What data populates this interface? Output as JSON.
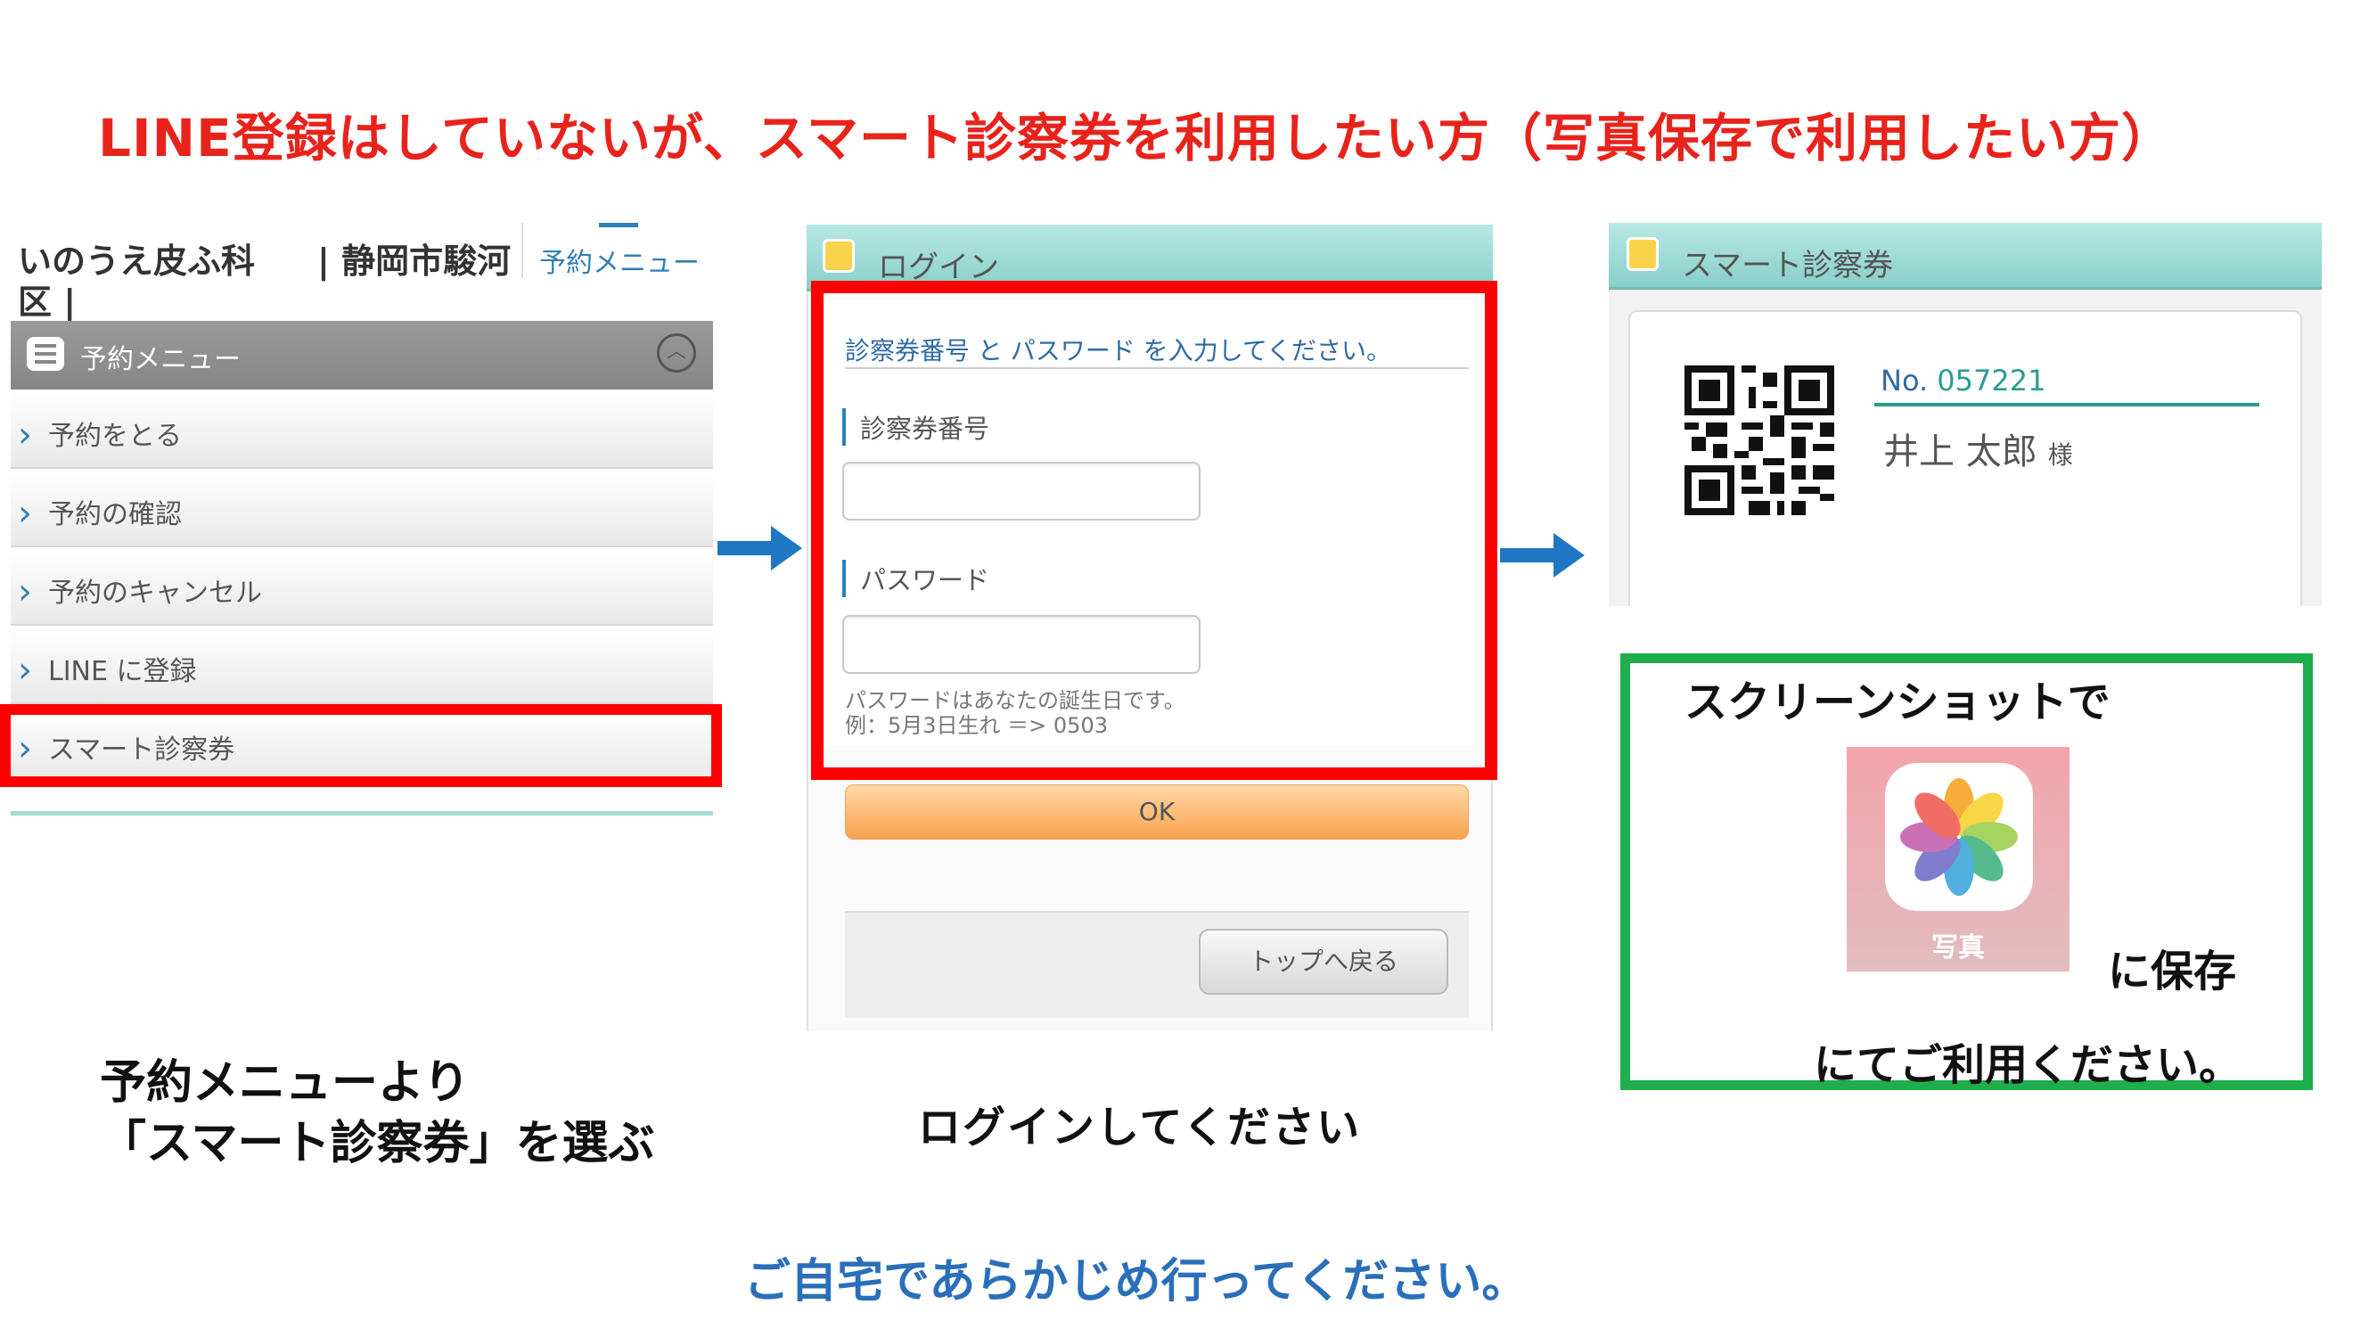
{
  "headline": "LINE登録はしていないが、スマート診察券を利用したい方（写真保存で利用したい方）",
  "menu_panel": {
    "clinic_name": "いのうえ皮ふ科",
    "clinic_location": "| 静岡市駿河",
    "clinic_location_cont": "区 |",
    "menu_link": "予約メニュー",
    "menu_header": "予約メニュー",
    "items": [
      {
        "label": "予約をとる"
      },
      {
        "label": "予約の確認"
      },
      {
        "label": "予約のキャンセル"
      },
      {
        "label": "LINE に登録"
      },
      {
        "label": "スマート診察券"
      }
    ]
  },
  "login_panel": {
    "title": "ログイン",
    "instruction": "診察券番号 と パスワード を入力してください。",
    "card_number_label": "診察券番号",
    "card_number_value": "",
    "password_label": "パスワード",
    "password_value": "",
    "password_hint": "パスワードはあなたの誕生日です。",
    "password_example": "例：5月3日生れ ＝> 0503",
    "ok_label": "OK",
    "back_label": "トップへ戻る"
  },
  "card_panel": {
    "title": "スマート診察券",
    "no_label": "No.",
    "number": "057221",
    "name": "井上 太郎",
    "honorific": "様"
  },
  "save_box": {
    "line1": "スクリーンショットで",
    "photos_label": "写真",
    "line2": "に保存",
    "line3": "にてご利用ください。"
  },
  "captions": {
    "menu_line1": "予約メニューより",
    "menu_line2": "「スマート診察券」を選ぶ",
    "login": "ログインしてください",
    "footer": "ご自宅であらかじめ行ってください。"
  },
  "colors": {
    "headline": "#e8231c",
    "highlight": "#ff0000",
    "green_box": "#1fae4b",
    "arrow": "#1f77c4",
    "titlebar": "#9ad8d3",
    "footer_text": "#2a6fba"
  }
}
